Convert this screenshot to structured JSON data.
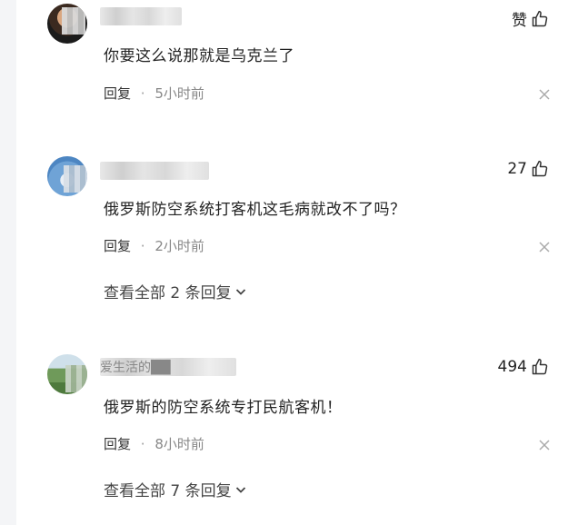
{
  "comments": [
    {
      "username": "██████",
      "likes": "赞",
      "text": "你要这么说那就是乌克兰了",
      "reply": "回复",
      "dot": "·",
      "time": "5小时前"
    },
    {
      "username": "██████",
      "likes": "27",
      "text": "俄罗斯防空系统打客机这毛病就改不了吗？",
      "reply": "回复",
      "dot": "·",
      "time": "2小时前",
      "more": "查看全部 2 条回复"
    },
    {
      "username": "爱生活的██",
      "likes": "494",
      "text": "俄罗斯的防空系统专打民航客机！",
      "reply": "回复",
      "dot": "·",
      "time": "8小时前",
      "more": "查看全部 7 条回复"
    }
  ],
  "colors": {
    "text": "#222222",
    "meta": "#888888",
    "strip": "#f4f5f7"
  },
  "icons": {
    "like": "thumbs-up-icon",
    "close": "close-icon",
    "expand": "chevron-down-icon"
  }
}
